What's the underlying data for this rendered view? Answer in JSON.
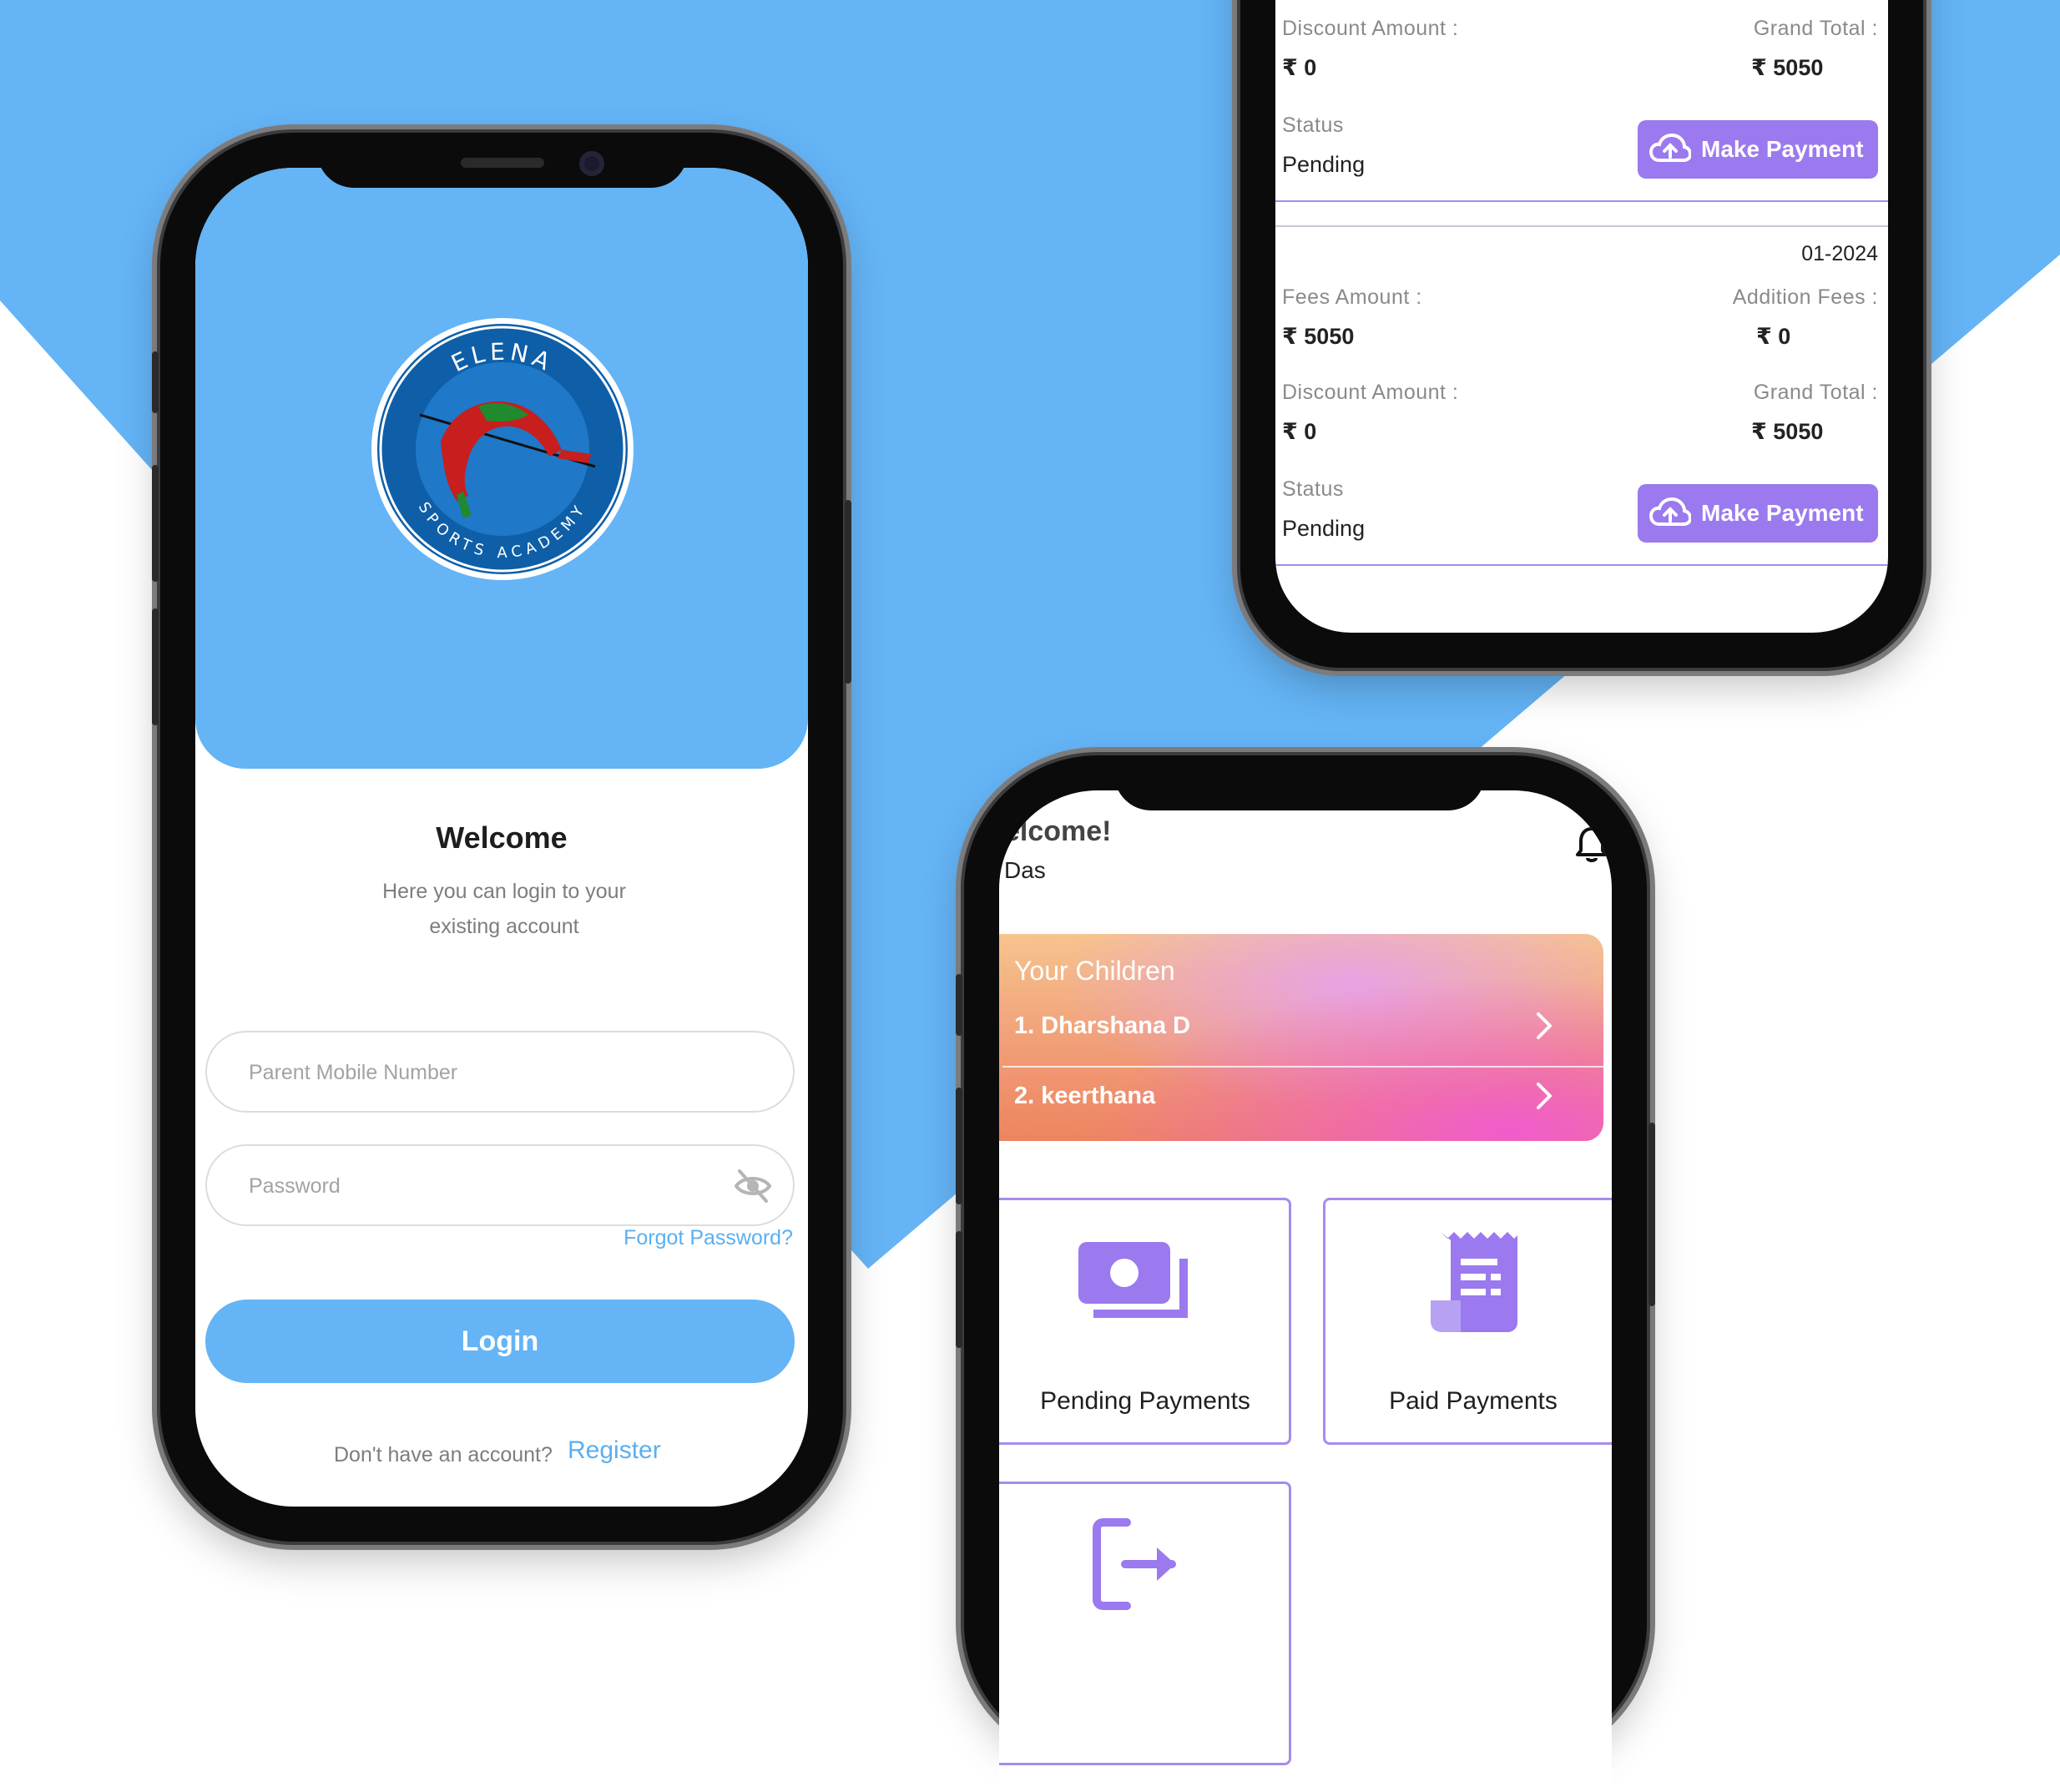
{
  "theme": {
    "background_blue": "#64b4f6",
    "accent_purple": "#9b79ee",
    "link_blue": "#5aaff0"
  },
  "login_screen": {
    "logo": {
      "top_text": "ELENA",
      "bottom_text": "SPORTS ACADEMY"
    },
    "title": "Welcome",
    "subtitle_line1": "Here you can login to your",
    "subtitle_line2": "existing account",
    "mobile_placeholder": "Parent Mobile Number",
    "password_placeholder": "Password",
    "password_toggle_icon": "eye-off-icon",
    "forgot_password": "Forgot Password?",
    "login_label": "Login",
    "no_account_text": "Don't have an account?",
    "register_label": "Register"
  },
  "payments_screen": {
    "records": [
      {
        "month": "",
        "discount_label": "Discount Amount :",
        "discount_value": "₹ 0",
        "grand_total_label": "Grand Total :",
        "grand_total_value": "₹ 5050",
        "status_label": "Status",
        "status_value": "Pending",
        "pay_label": "Make Payment"
      },
      {
        "month": "01-2024",
        "fees_label": "Fees Amount :",
        "fees_value": "₹ 5050",
        "addition_label": "Addition Fees :",
        "addition_value": "₹ 0",
        "discount_label": "Discount Amount :",
        "discount_value": "₹ 0",
        "grand_total_label": "Grand Total :",
        "grand_total_value": "₹ 5050",
        "status_label": "Status",
        "status_value": "Pending",
        "pay_label": "Make Payment"
      }
    ],
    "pay_icon": "cloud-upload-icon"
  },
  "dashboard_screen": {
    "welcome": "elcome!",
    "user_name": "Das",
    "notification_icon": "bell-icon",
    "children_title": "Your Children",
    "children": [
      {
        "label": "1. Dharshana D"
      },
      {
        "label": "2. keerthana"
      }
    ],
    "tiles": [
      {
        "label": "Pending Payments",
        "icon": "cash-icon"
      },
      {
        "label": "Paid Payments",
        "icon": "receipt-icon"
      },
      {
        "label": "",
        "icon": "logout-icon"
      }
    ]
  }
}
